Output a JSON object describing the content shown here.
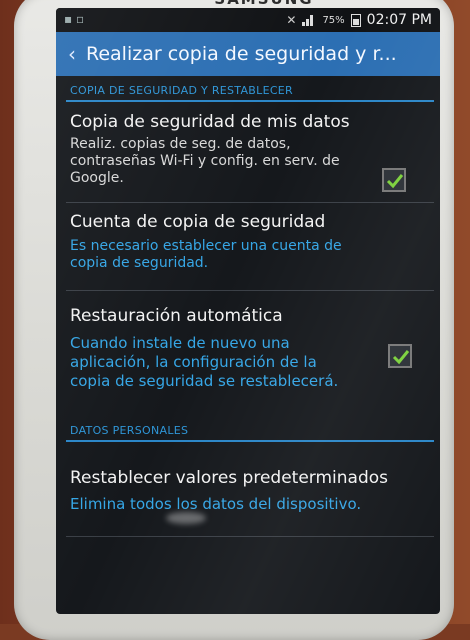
{
  "device": {
    "brand": "SAMSUNG"
  },
  "statusbar": {
    "battery": "75%",
    "time": "02:07 PM"
  },
  "actionbar": {
    "title": "Realizar copia de seguridad y r..."
  },
  "sections": {
    "backup_header": "COPIA DE SEGURIDAD Y RESTABLECER",
    "personal_header": "DATOS PERSONALES"
  },
  "items": {
    "backup_data": {
      "title": "Copia de seguridad de mis datos",
      "subtitle": "Realiz. copias de seg. de datos, contraseñas Wi-Fi y config. en serv. de Google.",
      "checked": true
    },
    "backup_account": {
      "title": "Cuenta de copia de seguridad",
      "subtitle": "Es necesario establecer una cuenta de copia de seguridad."
    },
    "auto_restore": {
      "title": "Restauración automática",
      "subtitle": "Cuando instale de nuevo una aplicación, la configuración de la copia de seguridad se restablecerá.",
      "checked": true
    },
    "factory_reset": {
      "title": "Restablecer valores predeterminados",
      "subtitle": "Elimina todos los datos del dispositivo."
    }
  },
  "colors": {
    "accent": "#2c6fb3",
    "link": "#35a6e6",
    "check": "#7bd13b"
  }
}
